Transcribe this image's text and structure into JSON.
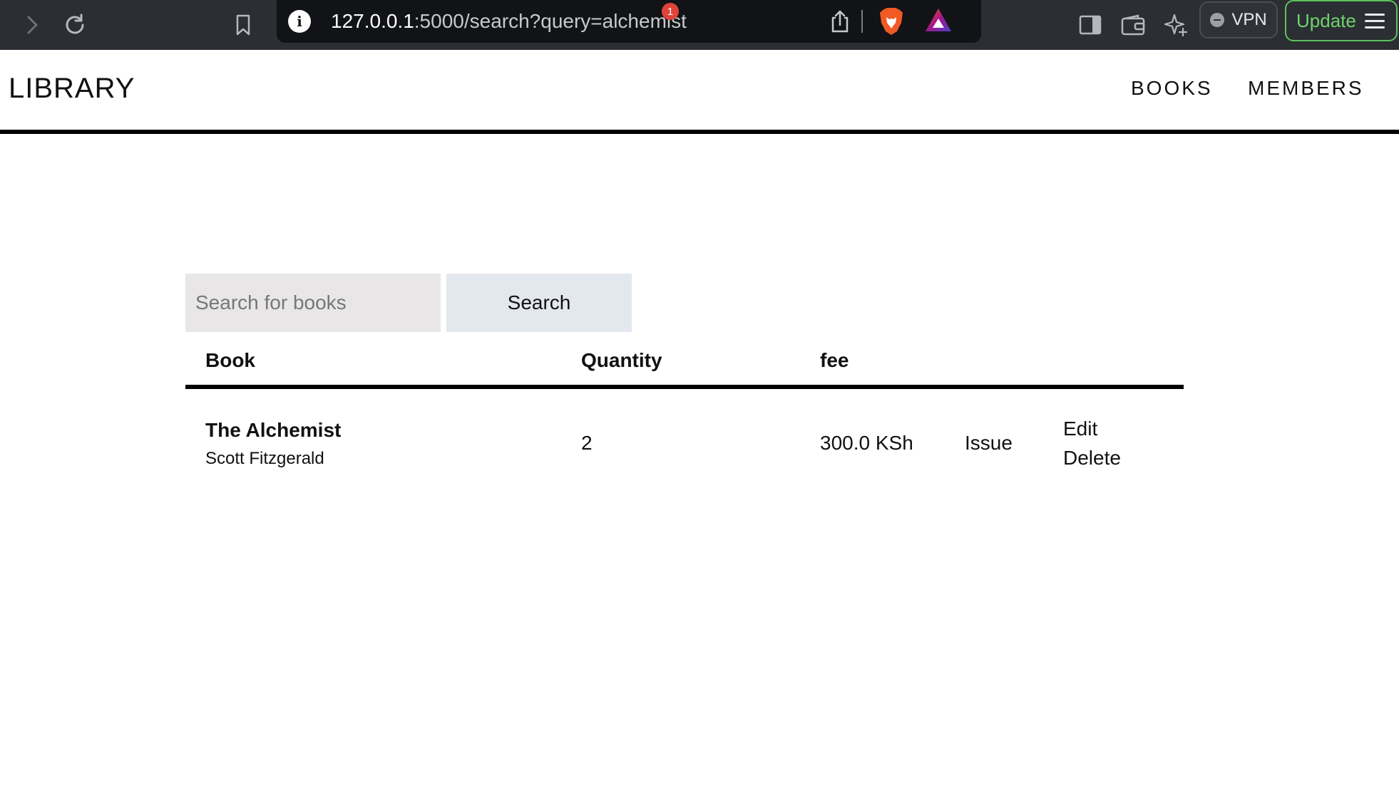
{
  "browser": {
    "url_host": "127.0.0.1",
    "url_rest": ":5000/search?query=alchemist",
    "info_icon_text": "i",
    "rewards_badge": "1",
    "vpn_label": "VPN",
    "update_label": "Update",
    "accent_update": "#6fd36c",
    "icons": [
      "forward-icon",
      "reload-icon",
      "bookmark-icon",
      "info-icon",
      "share-icon",
      "brave-lion-icon",
      "brave-rewards-icon",
      "sidebar-icon",
      "wallet-icon",
      "leo-ai-icon",
      "vpn-icon",
      "menu-icon"
    ]
  },
  "nav": {
    "brand": "LIBRARY",
    "links": [
      {
        "label": "BOOKS"
      },
      {
        "label": "MEMBERS"
      }
    ]
  },
  "search": {
    "placeholder": "Search for books",
    "value": "",
    "button_label": "Search"
  },
  "table": {
    "headers": {
      "book": "Book",
      "quantity": "Quantity",
      "fee": "fee"
    },
    "rows": [
      {
        "title": "The Alchemist",
        "author": "Scott Fitzgerald",
        "quantity": "2",
        "fee": "300.0 KSh",
        "issue_label": "Issue",
        "edit_label": "Edit",
        "delete_label": "Delete"
      }
    ]
  }
}
